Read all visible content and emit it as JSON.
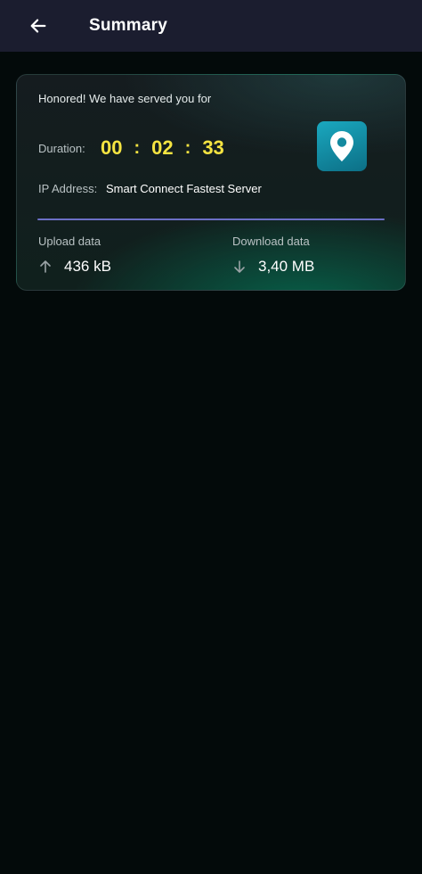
{
  "app_bar": {
    "title": "Summary",
    "back_icon": "arrow-left-icon"
  },
  "summary_card": {
    "message": "Honored! We have served you for",
    "duration": {
      "label": "Duration:",
      "hours": "00",
      "minutes": "02",
      "seconds": "33",
      "separator": ":"
    },
    "location_icon": "map-pin-icon",
    "ip": {
      "label": "IP Address:",
      "value": "Smart Connect Fastest Server"
    },
    "upload": {
      "label": "Upload data",
      "value": "436 kB",
      "icon": "arrow-up-icon"
    },
    "download": {
      "label": "Download data",
      "value": "3,40 MB",
      "icon": "arrow-down-icon"
    }
  },
  "colors": {
    "app_bar": "#1b1d2f",
    "background": "#030a0a",
    "timer": "#f5e441",
    "badge": "#1aa8bf",
    "divider": "#6b6fc6"
  }
}
